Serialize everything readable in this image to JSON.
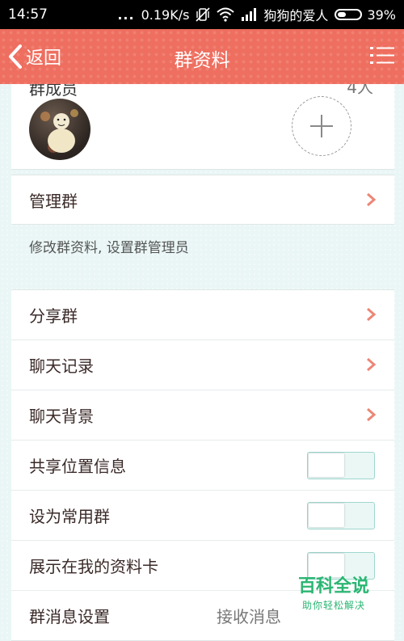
{
  "status_bar": {
    "time": "14:57",
    "dots": "...",
    "speed": "0.19K/s",
    "carrier": "狗狗的爱人",
    "battery": "39%"
  },
  "nav": {
    "back_label": "返回",
    "title": "群资料"
  },
  "members": {
    "label_partial": "群成员",
    "value_partial": "4人"
  },
  "manage": {
    "label": "管理群",
    "hint": "修改群资料, 设置群管理员"
  },
  "list": {
    "share": "分享群",
    "history": "聊天记录",
    "background": "聊天背景",
    "share_location": "共享位置信息",
    "frequent": "设为常用群",
    "show_in_card": "展示在我的资料卡",
    "msg_settings": "群消息设置",
    "msg_settings_value": "接收消息"
  },
  "toggles": {
    "share_location": false,
    "frequent": false,
    "show_in_card": false
  },
  "watermark": {
    "title": "百科全说",
    "subtitle": "助你轻松解决"
  },
  "colors": {
    "accent": "#ee6e5f",
    "chevron": "#ec8676",
    "toggle_border": "#9fd7cf",
    "watermark": "#2bb673"
  }
}
